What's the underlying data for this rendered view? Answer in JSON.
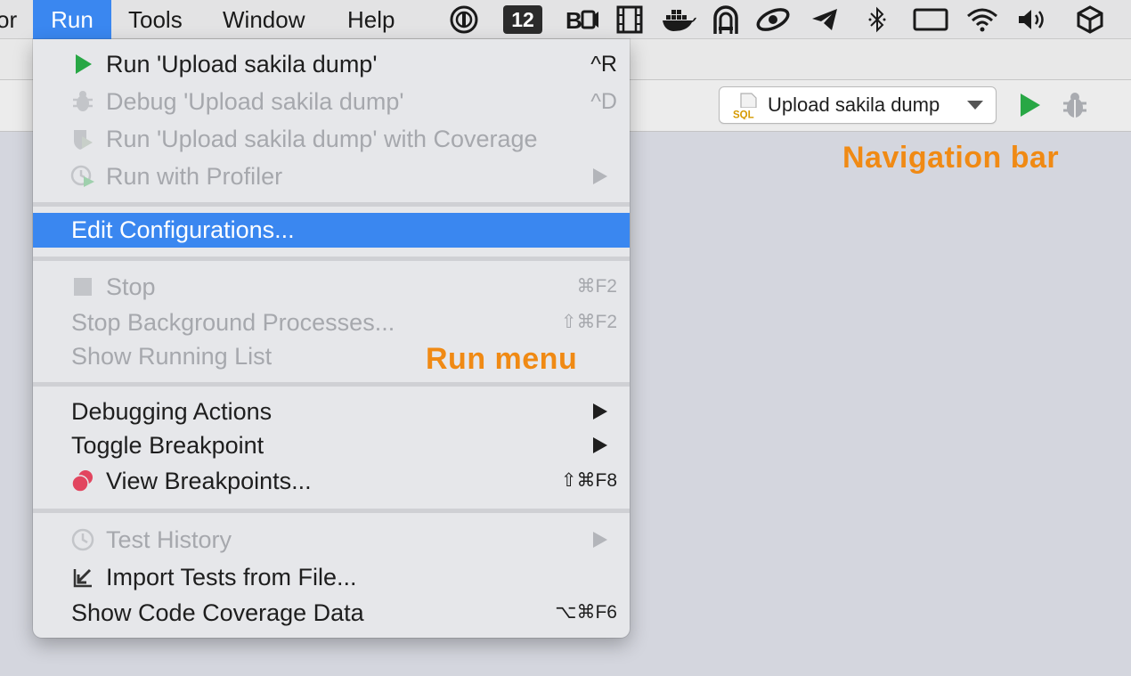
{
  "menubar": {
    "items": [
      {
        "label": "or"
      },
      {
        "label": "Run"
      },
      {
        "label": "Tools"
      },
      {
        "label": "Window"
      },
      {
        "label": "Help"
      }
    ],
    "tray": {
      "badge_number": "12",
      "icons": [
        "onepassword-icon",
        "calendar-badge-icon",
        "screen-recorder-icon",
        "film-icon",
        "docker-icon",
        "vpn-lock-icon",
        "cloud-app-icon",
        "telegram-icon",
        "bluetooth-icon",
        "display-icon",
        "wifi-icon",
        "volume-icon",
        "package-icon"
      ]
    }
  },
  "toolbar": {
    "run_configuration": "Upload sakila dump",
    "sql_badge": "SQL"
  },
  "annotations": {
    "navigation_bar": "Navigation bar",
    "run_menu": "Run menu"
  },
  "run_menu": {
    "run": {
      "label": "Run 'Upload sakila dump'",
      "shortcut": "^R"
    },
    "debug": {
      "label": "Debug 'Upload sakila dump'",
      "shortcut": "^D"
    },
    "coverage": {
      "label": "Run 'Upload sakila dump' with Coverage"
    },
    "profiler": {
      "label": "Run with Profiler"
    },
    "edit_configurations": {
      "label": "Edit Configurations..."
    },
    "stop": {
      "label": "Stop",
      "shortcut": "⌘F2"
    },
    "stop_background": {
      "label": "Stop Background Processes...",
      "shortcut": "⇧⌘F2"
    },
    "show_running": {
      "label": "Show Running List"
    },
    "debugging_actions": {
      "label": "Debugging Actions"
    },
    "toggle_breakpoint": {
      "label": "Toggle Breakpoint"
    },
    "view_breakpoints": {
      "label": "View Breakpoints...",
      "shortcut": "⇧⌘F8"
    },
    "test_history": {
      "label": "Test History"
    },
    "import_tests": {
      "label": "Import Tests from File..."
    },
    "show_coverage": {
      "label": "Show Code Coverage Data",
      "shortcut": "⌥⌘F6"
    }
  },
  "colors": {
    "accent": "#3a87f0",
    "annotation": "#f08a14",
    "run_green": "#28a745",
    "breakpoint_red": "#e2455f",
    "disabled_text": "#a6a8ad"
  }
}
